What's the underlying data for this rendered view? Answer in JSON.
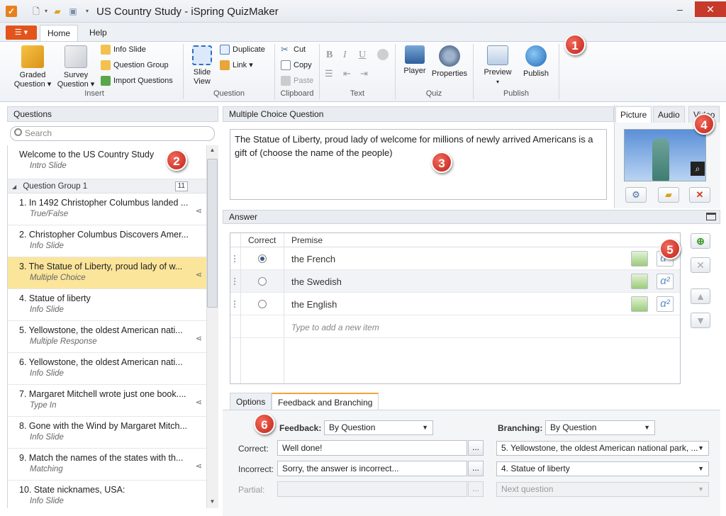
{
  "window": {
    "title": "US Country Study - iSpring QuizMaker",
    "app_icon": "checkbox-icon",
    "controls": {
      "minimize": "–",
      "maximize": "□",
      "close": "✕"
    }
  },
  "ribbon": {
    "file_menu": "☰ ▾",
    "tabs": [
      "Home",
      "Help"
    ],
    "active_tab": "Home",
    "groups": {
      "insert": {
        "label": "Insert",
        "graded_question": "Graded\nQuestion ▾",
        "survey_question": "Survey\nQuestion ▾",
        "info_slide": "Info Slide",
        "question_group": "Question Group",
        "import_questions": "Import Questions"
      },
      "question": {
        "label": "Question",
        "slide_view": "Slide\nView",
        "duplicate": "Duplicate",
        "link": "Link ▾"
      },
      "clipboard": {
        "label": "Clipboard",
        "cut": "Cut",
        "copy": "Copy",
        "paste": "Paste"
      },
      "text": {
        "label": "Text",
        "bold": "B",
        "italic": "I",
        "underline": "U"
      },
      "quiz": {
        "label": "Quiz",
        "player": "Player",
        "properties": "Properties"
      },
      "publish": {
        "label": "Publish",
        "preview": "Preview",
        "preview_arrow": "▾",
        "publish": "Publish"
      }
    }
  },
  "callouts": [
    "1",
    "2",
    "3",
    "4",
    "5",
    "6"
  ],
  "questions_panel": {
    "title": "Questions",
    "search_placeholder": "Search",
    "intro": {
      "title": "Welcome to the US Country Study",
      "subtitle": "Intro Slide"
    },
    "group": {
      "label": "Question Group 1",
      "count": "11",
      "toggle": "◢"
    },
    "items": [
      {
        "title": "1. In 1492 Christopher Columbus landed ...",
        "subtitle": "True/False",
        "branch": true
      },
      {
        "title": "2. Christopher Columbus Discovers Amer...",
        "subtitle": "Info Slide",
        "branch": false
      },
      {
        "title": "3. The Statue of Liberty, proud lady of w...",
        "subtitle": "Multiple Choice",
        "branch": true,
        "selected": true
      },
      {
        "title": "4. Statue of liberty",
        "subtitle": "Info Slide",
        "branch": false
      },
      {
        "title": "5. Yellowstone, the oldest American nati...",
        "subtitle": "Multiple Response",
        "branch": true
      },
      {
        "title": "6. Yellowstone, the oldest American nati...",
        "subtitle": "Info Slide",
        "branch": false
      },
      {
        "title": "7. Margaret Mitchell wrote just one book....",
        "subtitle": "Type In",
        "branch": true
      },
      {
        "title": "8. Gone with the Wind by Margaret Mitch...",
        "subtitle": "Info Slide",
        "branch": false
      },
      {
        "title": "9. Match the names of the states with th...",
        "subtitle": "Matching",
        "branch": true
      },
      {
        "title": "10. State nicknames, USA:",
        "subtitle": "Info Slide",
        "branch": false
      }
    ]
  },
  "editor": {
    "header": "Multiple Choice Question",
    "question_text": "The Statue of Liberty, proud lady of welcome for millions of newly arrived Americans is a gift of (choose the name of the people)",
    "media_tabs": [
      "Picture",
      "Audio",
      "Video"
    ],
    "active_media_tab": "Picture"
  },
  "answer": {
    "header": "Answer",
    "columns": [
      "Correct",
      "Premise"
    ],
    "rows": [
      {
        "premise": "the French",
        "correct": true
      },
      {
        "premise": "the Swedish",
        "correct": false
      },
      {
        "premise": "the English",
        "correct": false
      }
    ],
    "new_item_placeholder": "Type to add a new item",
    "alpha_label": "α²"
  },
  "feedback": {
    "tabs": [
      "Options",
      "Feedback and Branching"
    ],
    "active_tab": "Feedback and Branching",
    "feedback_label": "Feedback:",
    "feedback_value": "By Question",
    "branching_label": "Branching:",
    "branching_value": "By Question",
    "correct_label": "Correct:",
    "correct_text": "Well done!",
    "correct_branch": "5. Yellowstone, the oldest American national park, ...",
    "incorrect_label": "Incorrect:",
    "incorrect_text": "Sorry, the answer is incorrect...",
    "incorrect_branch": "4. Statue of liberty",
    "partial_label": "Partial:",
    "partial_branch": "Next question",
    "dots": "..."
  },
  "colors": {
    "accent": "#e2541b",
    "selection": "#fbe59a",
    "callout": "#c1231a"
  }
}
